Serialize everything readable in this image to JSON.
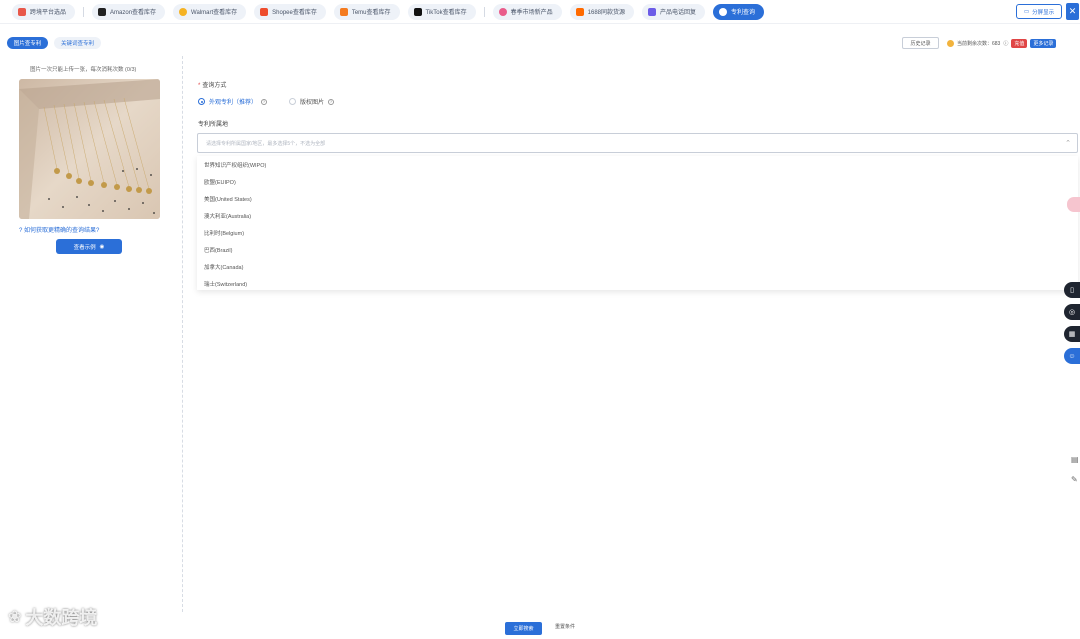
{
  "top_tabs": [
    {
      "label": "跨境平台选品",
      "color": "#e8584a"
    },
    {
      "label": "Amazon查看库存",
      "color": "#222222"
    },
    {
      "label": "Walmart查看库存",
      "color": "#f5b324"
    },
    {
      "label": "Shopee查看库存",
      "color": "#ee4d2d"
    },
    {
      "label": "Temu查看库存",
      "color": "#f47b20"
    },
    {
      "label": "TikTok查看库存",
      "color": "#111111"
    },
    {
      "label": "春季市场新产品",
      "color": "#e95c8a"
    },
    {
      "label": "1688同款货源",
      "color": "#ff6a00"
    },
    {
      "label": "产品电话回复",
      "color": "#6c5ce7"
    },
    {
      "label": "专利查询",
      "color": "#ffffff"
    }
  ],
  "split_label": "分屏显示",
  "close_glyph": "✕",
  "subtabs": {
    "active": "图片查专利",
    "inactive": "关键词查专利"
  },
  "history_label": "历史记录",
  "account": {
    "text": "当前剩余次数：683",
    "red_badge": "充值",
    "blue_badge": "更多记录"
  },
  "left": {
    "tip": "图片一次只能上传一张，每次消耗次数 (0/3)",
    "help": "如何获取更精确的查询结果?",
    "view_button": "查看示例"
  },
  "form": {
    "method_label": "查询方式",
    "option_a": "外观专利（推荐）",
    "option_b": "版权图片",
    "region_label": "专利所属地",
    "region_placeholder": "请选择专利所属国家/地区，最多选择5个，不选为全部",
    "region_options": [
      "世界知识产权组织(WIPO)",
      "欧盟(EUIPO)",
      "美国(United States)",
      "澳大利亚(Australia)",
      "比利时(Belgium)",
      "巴西(Brazil)",
      "加拿大(Canada)",
      "瑞士(Switzerland)"
    ]
  },
  "bottom": {
    "submit": "立即搜索",
    "reset": "重置条件"
  },
  "watermark_text": "大数跨境"
}
